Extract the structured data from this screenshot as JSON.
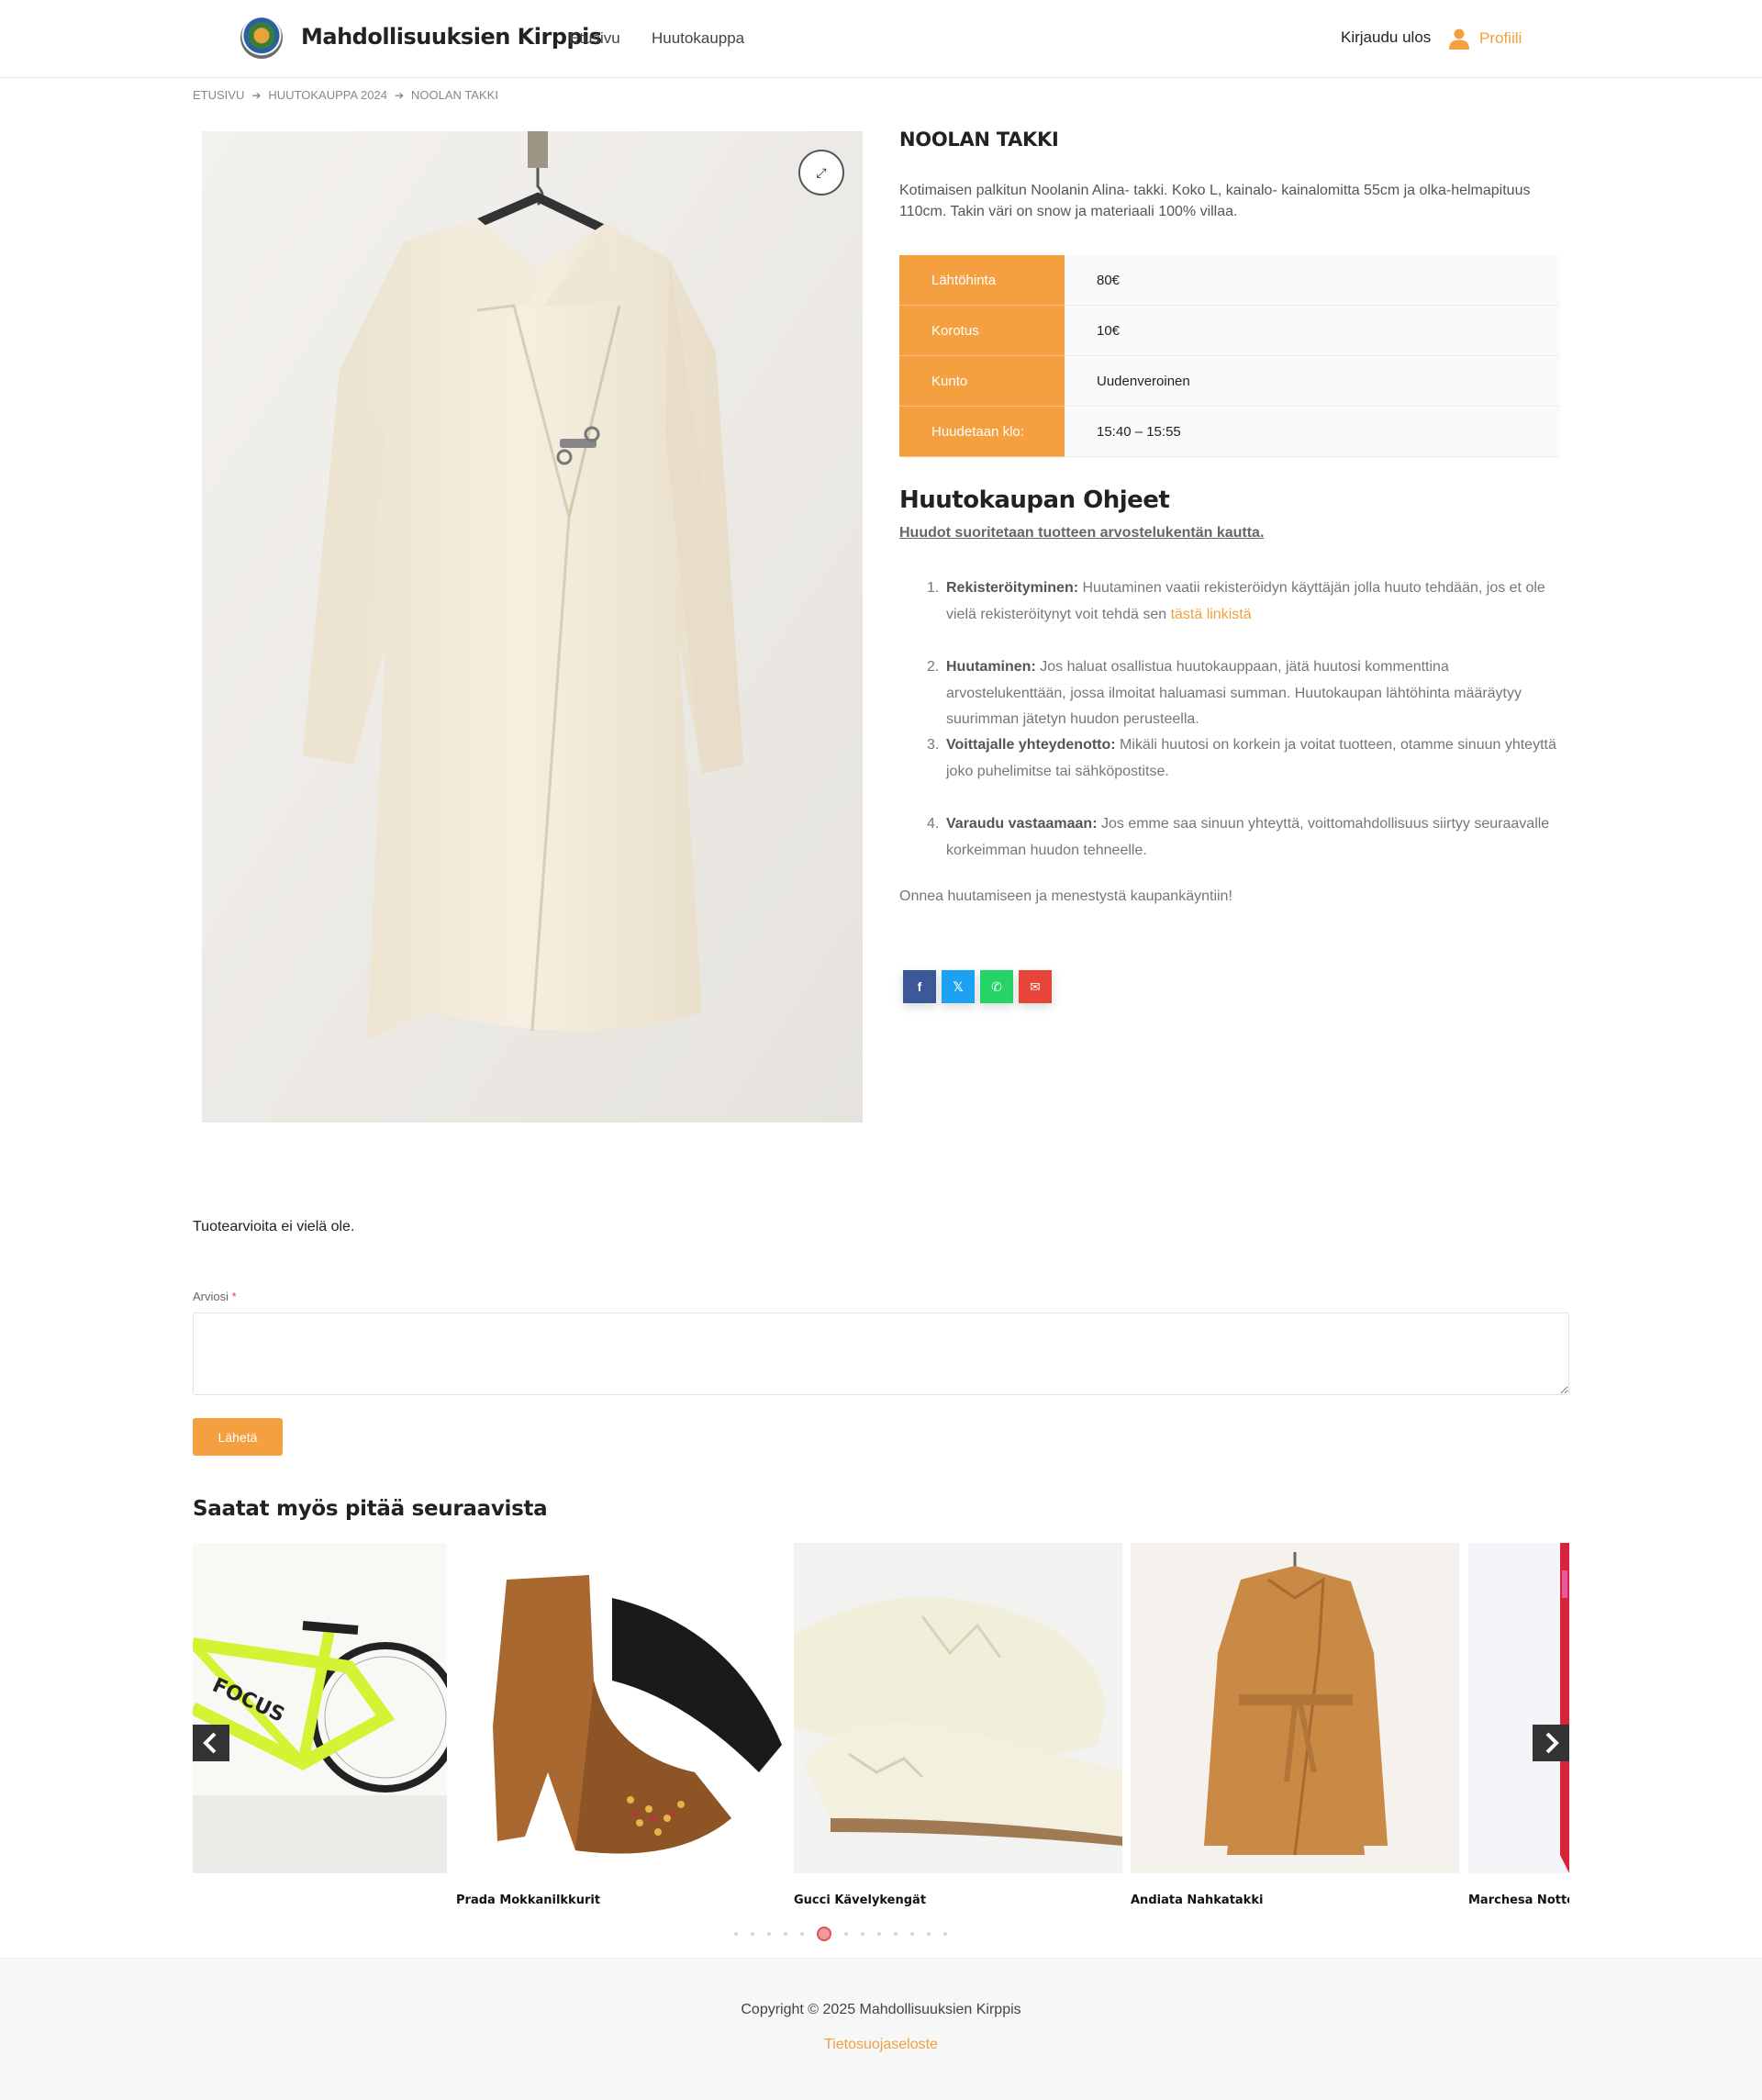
{
  "header": {
    "site_title": "Mahdollisuuksien Kirppis",
    "nav": [
      "Etusivu",
      "Huutokauppa"
    ],
    "logout": "Kirjaudu ulos",
    "profile": "Profiili"
  },
  "breadcrumb": [
    "ETUSIVU",
    "HUUTOKAUPPA 2024",
    "NOOLAN TAKKI"
  ],
  "product": {
    "title": "NOOLAN TAKKI",
    "description": "Kotimaisen palkitun Noolanin Alina- takki. Koko L, kainalo- kainalomitta 55cm ja olka-helmapituus 110cm. Takin väri on snow ja materiaali 100% villaa.",
    "attributes": [
      {
        "label": "Lähtöhinta",
        "value": "80€"
      },
      {
        "label": "Korotus",
        "value": "10€"
      },
      {
        "label": "Kunto",
        "value": "Uudenveroinen"
      },
      {
        "label": "Huudetaan klo:",
        "value": "15:40 – 15:55"
      }
    ]
  },
  "guide": {
    "title": "Huutokaupan Ohjeet",
    "subtitle": "Huudot suoritetaan tuotteen arvostelukentän kautta.",
    "items": [
      {
        "num": "1.",
        "bold": "Rekisteröityminen:",
        "text": " Huutaminen vaatii rekisteröidyn käyttäjän jolla huuto tehdään, jos et ole vielä rekisteröitynyt voit tehdä sen ",
        "link": "tästä linkistä"
      },
      {
        "num": "2.",
        "bold": "Huutaminen:",
        "text": " Jos haluat osallistua huutokauppaan, jätä huutosi kommenttina arvostelukenttään, jossa ilmoitat haluamasi summan. Huutokaupan lähtöhinta määräytyy suurimman jätetyn huudon perusteella."
      },
      {
        "num": "3.",
        "bold": "Voittajalle yhteydenotto:",
        "text": " Mikäli huutosi on korkein ja voitat tuotteen, otamme sinuun yhteyttä joko puhelimitse tai sähköpostitse."
      },
      {
        "num": "4.",
        "bold": "Varaudu vastaamaan:",
        "text": " Jos emme saa sinuun yhteyttä, voittomahdollisuus siirtyy seuraavalle korkeimman huudon tehneelle."
      }
    ],
    "good_luck": "Onnea huutamiseen ja menestystä kaupankäyntiin!"
  },
  "share": [
    {
      "icon": "facebook-icon",
      "glyph": "f",
      "color": "#3b5998"
    },
    {
      "icon": "x-icon",
      "glyph": "𝕏",
      "color": "#1da1f2"
    },
    {
      "icon": "whatsapp-icon",
      "glyph": "✆",
      "color": "#25d366"
    },
    {
      "icon": "mail-icon",
      "glyph": "✉",
      "color": "#e8443a"
    }
  ],
  "reviews": {
    "empty_text": "Tuotearvioita ei vielä ole.",
    "field_label": "Arviosi",
    "required_mark": "*",
    "submit": "Lähetä"
  },
  "related": {
    "title": "Saatat myös pitää seuraavista",
    "items": [
      {
        "name": "",
        "image": "bicycle"
      },
      {
        "name": "Prada Mokkanilkkurit",
        "image": "suede-ankle-boot"
      },
      {
        "name": "Gucci Kävelykengät",
        "image": "white-oxford-shoe"
      },
      {
        "name": "Andiata Nahkatakki",
        "image": "suede-coat"
      },
      {
        "name": "Marchesa Notte Ilta",
        "image": "red-dress"
      }
    ],
    "dots_count": 13,
    "active_dot": 5
  },
  "footer": {
    "copyright": "Copyright © 2025 Mahdollisuuksien Kirppis",
    "privacy": "Tietosuojaseloste"
  },
  "colors": {
    "accent": "#f4a040",
    "text": "#222222"
  }
}
